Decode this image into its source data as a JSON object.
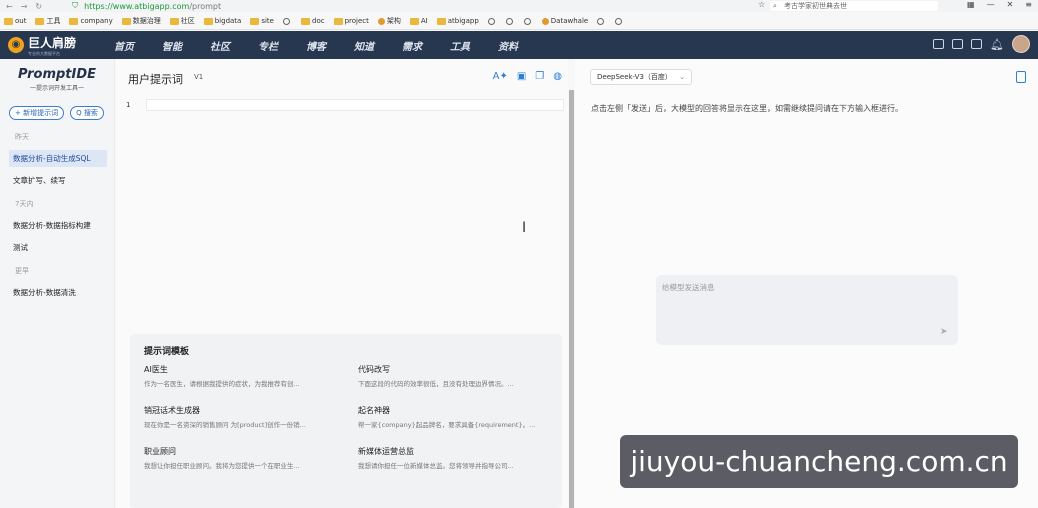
{
  "browser": {
    "url_host": "https://www.atbigapp.com",
    "url_path": "/prompt",
    "search_text": "考古学家初世典去世",
    "bookmarks": [
      {
        "label": "out",
        "icon": "folder"
      },
      {
        "label": "工具",
        "icon": "folder"
      },
      {
        "label": "company",
        "icon": "folder"
      },
      {
        "label": "数据治理",
        "icon": "folder"
      },
      {
        "label": "社区",
        "icon": "folder"
      },
      {
        "label": "bigdata",
        "icon": "folder"
      },
      {
        "label": "site",
        "icon": "folder"
      },
      {
        "label": "",
        "icon": "globe"
      },
      {
        "label": "doc",
        "icon": "folder"
      },
      {
        "label": "project",
        "icon": "folder"
      },
      {
        "label": "架构",
        "icon": "dot"
      },
      {
        "label": "AI",
        "icon": "folder"
      },
      {
        "label": "atbigapp",
        "icon": "folder"
      },
      {
        "label": "",
        "icon": "globe"
      },
      {
        "label": "",
        "icon": "globe"
      },
      {
        "label": "",
        "icon": "globe"
      },
      {
        "label": "Datawhale",
        "icon": "dot"
      },
      {
        "label": "",
        "icon": "globe"
      },
      {
        "label": "",
        "icon": "globe"
      }
    ]
  },
  "topnav": {
    "logo": "巨人肩膀",
    "logo_sub": "专业的大数据平台",
    "menu": [
      "首页",
      "智能",
      "社区",
      "专栏",
      "博客",
      "知道",
      "需求",
      "工具",
      "资料"
    ]
  },
  "sidebar": {
    "brand": "PromptIDE",
    "brand_sub": "一提示词开发工具一",
    "new_button": "+ 新增提示词",
    "search_button": "Q 搜索",
    "groups": [
      {
        "label": "昨天",
        "items": [
          {
            "label": "数据分析-自动生成SQL",
            "active": true
          },
          {
            "label": "文章扩写、续写",
            "active": false
          }
        ]
      },
      {
        "label": "7天内",
        "items": [
          {
            "label": "数据分析-数据指标构建",
            "active": false
          },
          {
            "label": "测试",
            "active": false
          }
        ]
      },
      {
        "label": "更早",
        "items": [
          {
            "label": "数据分析-数据清洗",
            "active": false
          }
        ]
      }
    ]
  },
  "editor": {
    "title": "用户提示词",
    "version": "V1",
    "line_number": "1",
    "templates_title": "提示词模板",
    "templates": [
      {
        "name": "AI医生",
        "desc": "作为一名医生，请根据我提供的症状，为我推荐有创..."
      },
      {
        "name": "代码改写",
        "desc": "下面这段的代码的效率很低，且没有处理边界情况。..."
      },
      {
        "name": "销冠话术生成器",
        "desc": "现在你是一名资深的销售顾问 为[product]创作一份销..."
      },
      {
        "name": "起名神器",
        "desc": "帮一家{company}起品牌名，要求具备{requirement}。..."
      },
      {
        "name": "职业顾问",
        "desc": "我想让你担任职业顾问。我将为您提供一个在职业生..."
      },
      {
        "name": "新媒体运营总监",
        "desc": "我想请你担任一位新媒体总监。您将领导并指导公司..."
      }
    ]
  },
  "chat": {
    "model": "DeepSeek-V3（百度）",
    "hint": "点击左侧「发送」后，大模型的回答将显示在这里，如需继续提问请在下方输入框进行。",
    "input_placeholder": "给模型发送消息"
  },
  "watermark": "jiuyou-chuancheng.com.cn"
}
